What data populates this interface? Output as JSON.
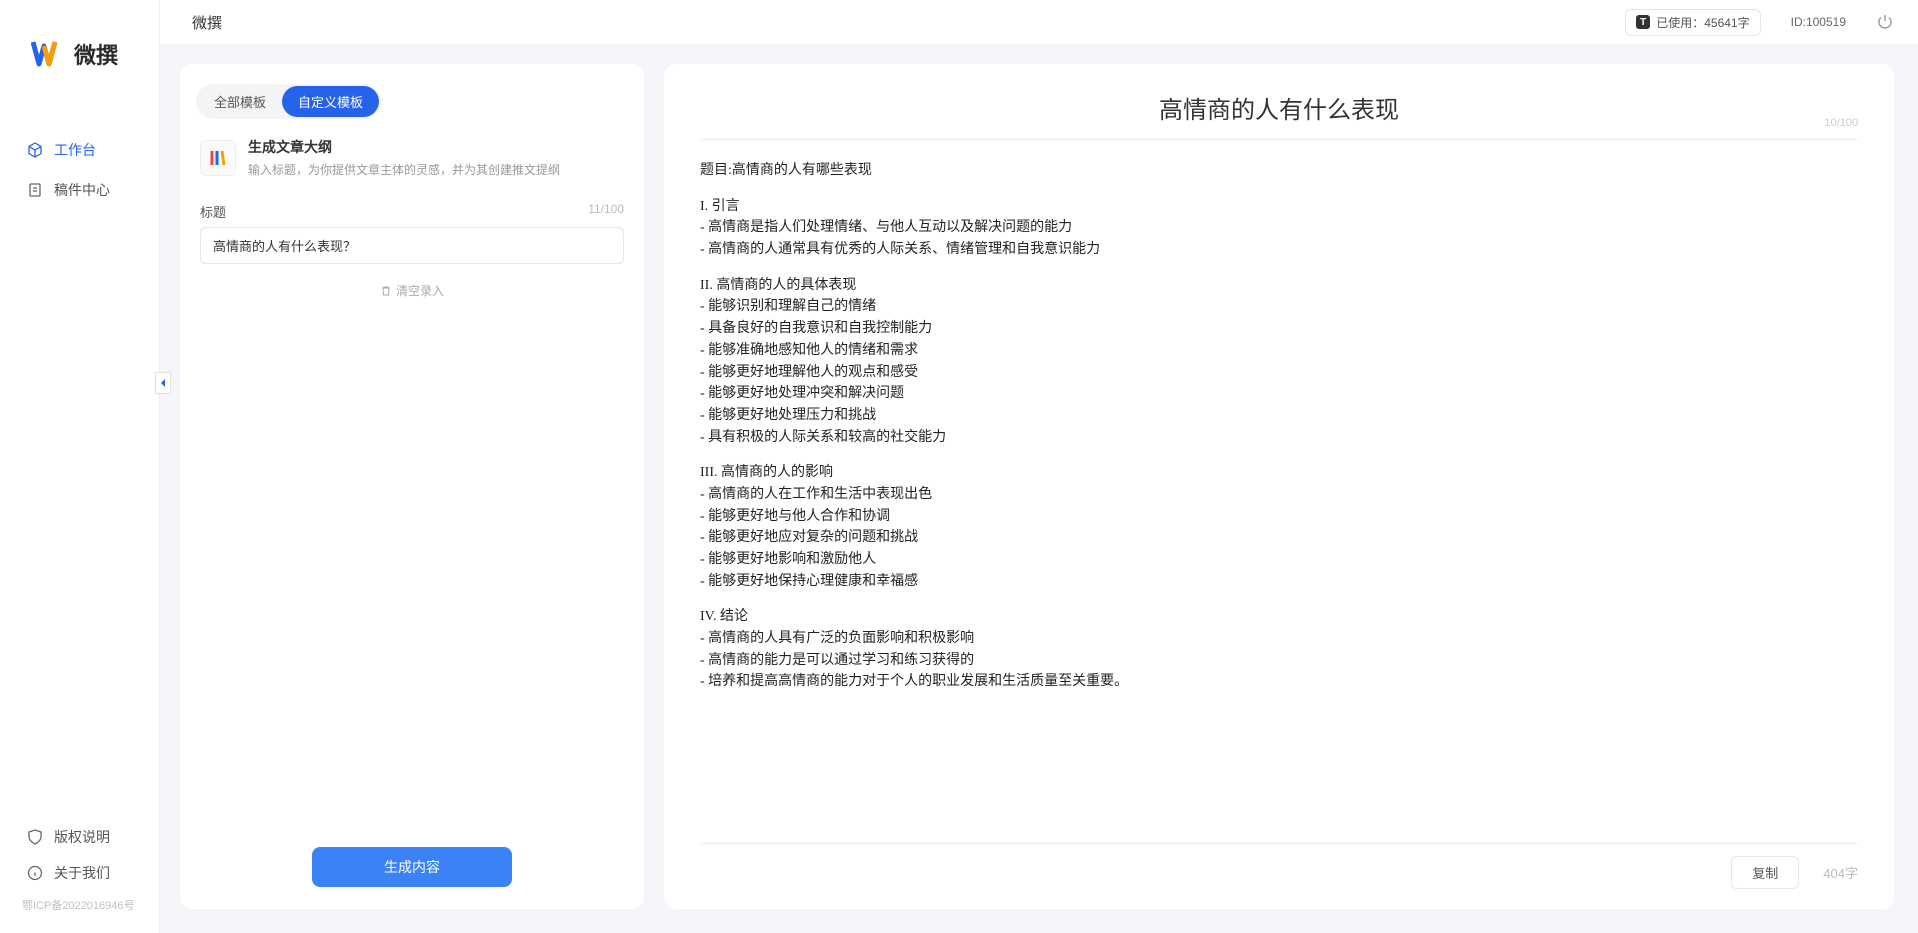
{
  "app": {
    "brand": "微撰",
    "icp": "鄂ICP备2022016946号"
  },
  "sidebar": {
    "items": [
      {
        "label": "工作台"
      },
      {
        "label": "稿件中心"
      }
    ],
    "bottom": [
      {
        "label": "版权说明"
      },
      {
        "label": "关于我们"
      }
    ]
  },
  "topbar": {
    "title": "微撰",
    "usage_label": "已使用：",
    "usage_value": "45641字",
    "id_label": "ID:100519"
  },
  "left_panel": {
    "tabs": [
      {
        "label": "全部模板"
      },
      {
        "label": "自定义模板"
      }
    ],
    "template": {
      "title": "生成文章大纲",
      "desc": "输入标题，为你提供文章主体的灵感，并为其创建推文提纲"
    },
    "form": {
      "title_label": "标题",
      "title_counter": "11/100",
      "title_value": "高情商的人有什么表现？",
      "clear_label": "清空录入"
    },
    "generate_label": "生成内容"
  },
  "right_panel": {
    "heading": "高情商的人有什么表现",
    "heading_counter": "10/100",
    "lines": [
      "题目:高情商的人有哪些表现",
      "",
      "I. 引言",
      "- 高情商是指人们处理情绪、与他人互动以及解决问题的能力",
      "- 高情商的人通常具有优秀的人际关系、情绪管理和自我意识能力",
      "",
      "II. 高情商的人的具体表现",
      "- 能够识别和理解自己的情绪",
      "- 具备良好的自我意识和自我控制能力",
      "- 能够准确地感知他人的情绪和需求",
      "- 能够更好地理解他人的观点和感受",
      "- 能够更好地处理冲突和解决问题",
      "- 能够更好地处理压力和挑战",
      "- 具有积极的人际关系和较高的社交能力",
      "",
      "III. 高情商的人的影响",
      "- 高情商的人在工作和生活中表现出色",
      "- 能够更好地与他人合作和协调",
      "- 能够更好地应对复杂的问题和挑战",
      "- 能够更好地影响和激励他人",
      "- 能够更好地保持心理健康和幸福感",
      "",
      "IV. 结论",
      "- 高情商的人具有广泛的负面影响和积极影响",
      "- 高情商的能力是可以通过学习和练习获得的",
      "- 培养和提高高情商的能力对于个人的职业发展和生活质量至关重要。"
    ],
    "copy_label": "复制",
    "word_count": "404字"
  }
}
